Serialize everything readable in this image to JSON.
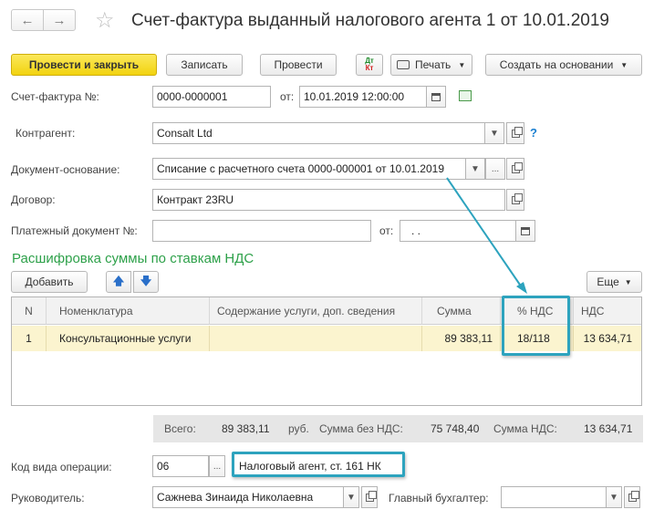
{
  "header": {
    "title": "Счет-фактура выданный налогового агента 1 от 10.01.2019",
    "star_icon": "star-icon"
  },
  "toolbar": {
    "post_close": "Провести и закрыть",
    "save": "Записать",
    "post": "Провести",
    "dt_kt_top": "Дт",
    "dt_kt_bottom": "Кт",
    "print": "Печать",
    "create_based": "Создать на основании"
  },
  "form": {
    "invoice_label": "Счет-фактура №:",
    "invoice_value": "0000-0000001",
    "from_label": "от:",
    "from_value": "10.01.2019 12:00:00",
    "counterparty_label": "Контрагент:",
    "counterparty_value": "Consalt Ltd",
    "base_doc_label": "Документ-основание:",
    "base_doc_value": "Списание с расчетного счета 0000-000001 от 10.01.2019",
    "contract_label": "Договор:",
    "contract_value": "Контракт 23RU",
    "payment_doc_label": "Платежный документ №:",
    "payment_doc_value": "",
    "payment_from_label": "от:",
    "payment_from_value": " .  ."
  },
  "section_title": "Расшифровка суммы по ставкам НДС",
  "table_toolbar": {
    "add": "Добавить",
    "more": "Еще"
  },
  "table": {
    "columns": [
      "N",
      "Номенклатура",
      "Содержание услуги, доп. сведения",
      "Сумма",
      "% НДС",
      "НДС"
    ],
    "rows": [
      [
        "1",
        "Консультационные услуги",
        "",
        "89 383,11",
        "18/118",
        "13 634,71"
      ]
    ]
  },
  "totals": {
    "total_label": "Всего:",
    "total_value": "89 383,11",
    "currency": "руб.",
    "without_vat_label": "Сумма без НДС:",
    "without_vat_value": "75 748,40",
    "vat_label": "Сумма НДС:",
    "vat_value": "13 634,71"
  },
  "footer": {
    "op_code_label": "Код вида операции:",
    "op_code_value": "06",
    "op_code_desc": "Налоговый агент, ст. 161 НК",
    "head_label": "Руководитель:",
    "head_value": "Сажнева Зинаида Николаевна",
    "chief_acc_label": "Главный бухгалтер:",
    "chief_acc_value": ""
  },
  "colors": {
    "accent_green": "#2ea14a",
    "highlight": "#2da3be",
    "primary_button": "#f2d30f",
    "selected_row": "#fbf4cf"
  }
}
